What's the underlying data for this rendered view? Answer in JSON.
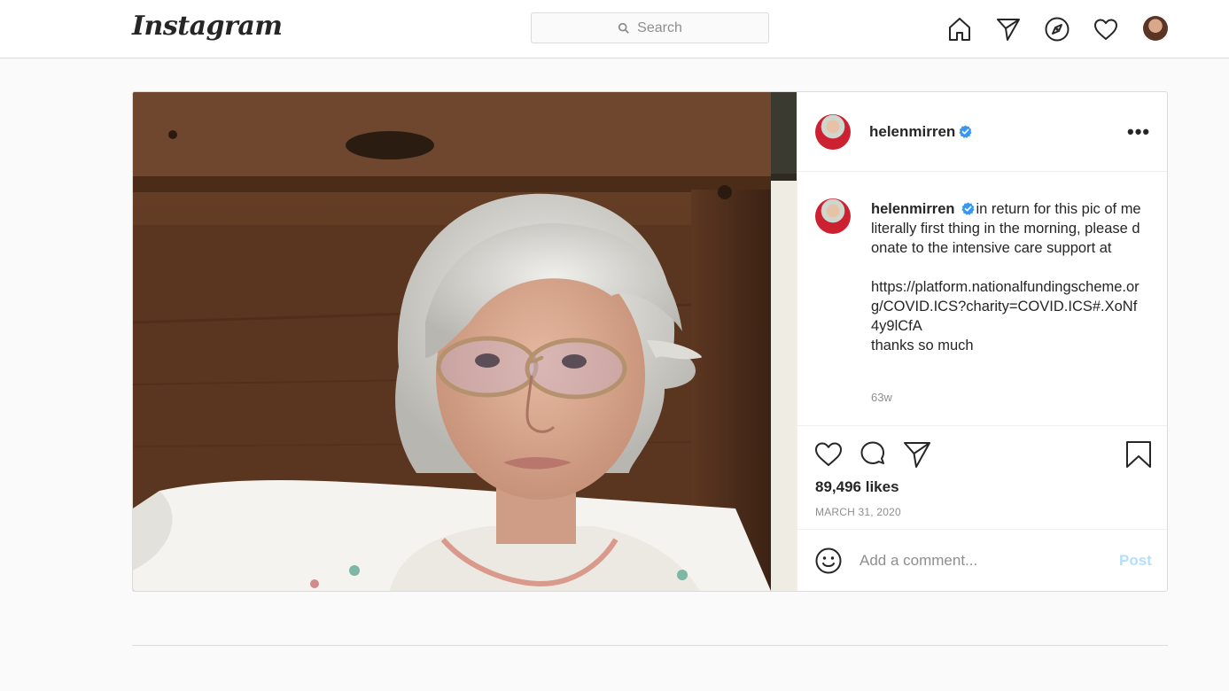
{
  "nav": {
    "logo": "Instagram",
    "search_placeholder": "Search",
    "icons": [
      "home-icon",
      "direct-icon",
      "explore-icon",
      "activity-heart-icon",
      "profile-avatar"
    ]
  },
  "post": {
    "username": "helenmirren",
    "verified": true,
    "more_label": "•••",
    "caption_username": "helenmirren",
    "caption_text": "in return for this pic of me literally first thing in the morning, please donate to the intensive care support at\n\nhttps://platform.nationalfundingscheme.org/COVID.ICS?charity=COVID.ICS#.XoNf4y9lCfA\nthanks so much",
    "caption_time": "63w",
    "likes": "89,496 likes",
    "date": "MARCH 31, 2020",
    "comment_placeholder": "Add a comment...",
    "post_button": "Post"
  },
  "colors": {
    "accent": "#0095f6",
    "verified": "#3897f0",
    "post_button_disabled": "#b2dffc",
    "border": "#dbdbdb",
    "background": "#fafafa"
  }
}
